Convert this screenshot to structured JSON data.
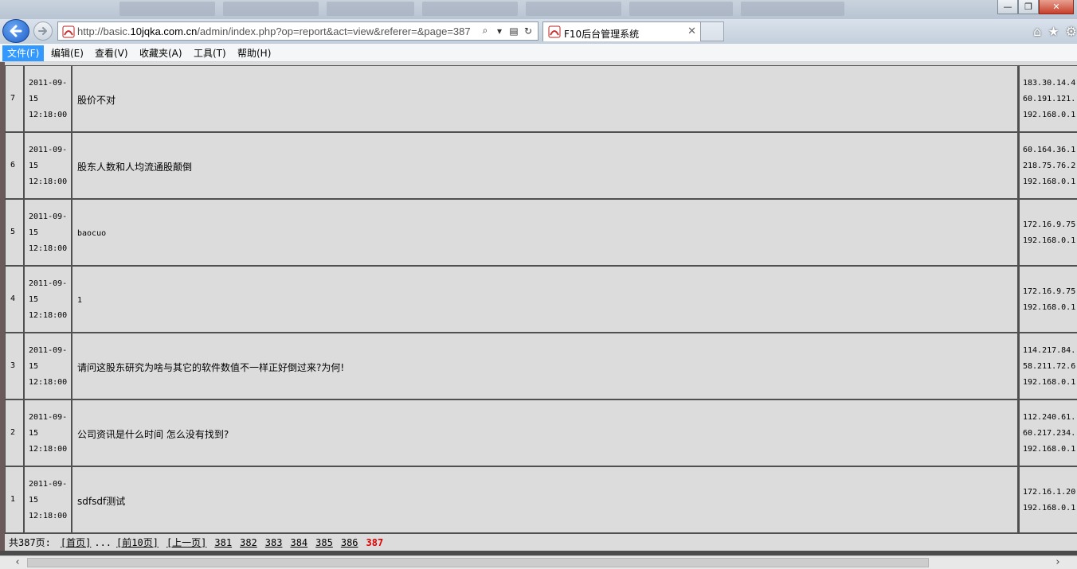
{
  "browser": {
    "url_prefix": "http://basic.",
    "url_domain": "10jqka.com.cn",
    "url_rest": "/admin/index.php?op=report&act=view&referer=&page=387",
    "tab_title": "F10后台管理系统",
    "window_buttons": {
      "minimize": "—",
      "maximize": "❐",
      "close": "✕"
    }
  },
  "menu": {
    "items": [
      "文件(F)",
      "编辑(E)",
      "查看(V)",
      "收藏夹(A)",
      "工具(T)",
      "帮助(H)"
    ],
    "selected": 0
  },
  "records": [
    {
      "id": "7",
      "date": "2011-09-",
      "day": "15",
      "time": "12:18:00",
      "message": "股价不对",
      "mono": false,
      "ips": [
        "183.30.14.4",
        "60.191.121.",
        "192.168.0.1"
      ]
    },
    {
      "id": "6",
      "date": "2011-09-",
      "day": "15",
      "time": "12:18:00",
      "message": "股东人数和人均流通股颠倒",
      "mono": false,
      "ips": [
        "60.164.36.1",
        "218.75.76.2",
        "192.168.0.1"
      ]
    },
    {
      "id": "5",
      "date": "2011-09-",
      "day": "15",
      "time": "12:18:00",
      "message": "baocuo",
      "mono": true,
      "ips": [
        "172.16.9.75",
        "192.168.0.1"
      ]
    },
    {
      "id": "4",
      "date": "2011-09-",
      "day": "15",
      "time": "12:18:00",
      "message": "1",
      "mono": true,
      "ips": [
        "172.16.9.75",
        "192.168.0.1"
      ]
    },
    {
      "id": "3",
      "date": "2011-09-",
      "day": "15",
      "time": "12:18:00",
      "message": "请问这股东研究为啥与其它的软件数值不一样正好倒过来?为何!",
      "mono": false,
      "ips": [
        "114.217.84.",
        "58.211.72.6",
        "192.168.0.1"
      ]
    },
    {
      "id": "2",
      "date": "2011-09-",
      "day": "15",
      "time": "12:18:00",
      "message": "公司资讯是什么时间 怎么没有找到?",
      "mono": false,
      "ips": [
        "112.240.61.",
        "60.217.234.",
        "192.168.0.1"
      ]
    },
    {
      "id": "1",
      "date": "2011-09-",
      "day": "15",
      "time": "12:18:00",
      "message": "sdfsdf测试",
      "mono": false,
      "ips": [
        "172.16.1.20",
        "192.168.0.1"
      ]
    }
  ],
  "pager": {
    "total": "共387页:",
    "first": "[首页]",
    "ellipsis": "...",
    "prev10": "[前10页]",
    "prev": "[上一页]",
    "pages": [
      "381",
      "382",
      "383",
      "384",
      "385",
      "386"
    ],
    "current": "387"
  }
}
